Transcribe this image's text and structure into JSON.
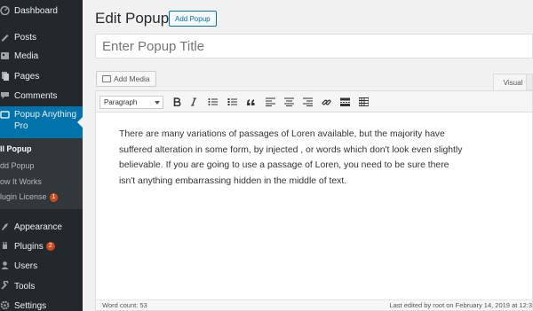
{
  "sidebar": {
    "items": [
      {
        "label": "Dashboard",
        "icon": "dashboard-icon"
      },
      {
        "label": "Posts",
        "icon": "posts-icon"
      },
      {
        "label": "Media",
        "icon": "media-icon"
      },
      {
        "label": "Pages",
        "icon": "pages-icon"
      },
      {
        "label": "Comments",
        "icon": "comments-icon"
      },
      {
        "label": "Popup Anything Pro",
        "icon": "popup-icon"
      },
      {
        "label": "Appearance",
        "icon": "appearance-icon"
      },
      {
        "label": "Plugins",
        "icon": "plugins-icon",
        "badge": "2"
      },
      {
        "label": "Users",
        "icon": "users-icon"
      },
      {
        "label": "Tools",
        "icon": "tools-icon"
      },
      {
        "label": "Settings",
        "icon": "settings-icon"
      }
    ],
    "active_line1": "Popup Anything",
    "active_line2": "Pro",
    "submenu": [
      {
        "label": "ll Popup"
      },
      {
        "label": "dd Popup"
      },
      {
        "label": "ow It Works"
      },
      {
        "label": "lugin License",
        "badge": "1"
      }
    ]
  },
  "header": {
    "title": "Edit Popup",
    "add_button": "Add Popup"
  },
  "title_field": {
    "placeholder": "Enter Popup Title"
  },
  "editor": {
    "add_media": "Add Media",
    "tab_visual": "Visual",
    "format": "Paragraph",
    "content": "There are many variations of passages of Loren  available, but the majority have suffered alteration in some form, by injected , or  words which don't look even slightly believable. If you are going to use a passage of Loren, you need to be sure there isn't anything embarrassing hidden in the middle of text.",
    "word_count": "Word count: 53",
    "last_edited": "Last edited by root on February 14, 2019 at 12:3"
  },
  "colors": {
    "sidebar_bg": "#23282d",
    "active_bg": "#0073aa",
    "badge": "#ca4a1f"
  }
}
